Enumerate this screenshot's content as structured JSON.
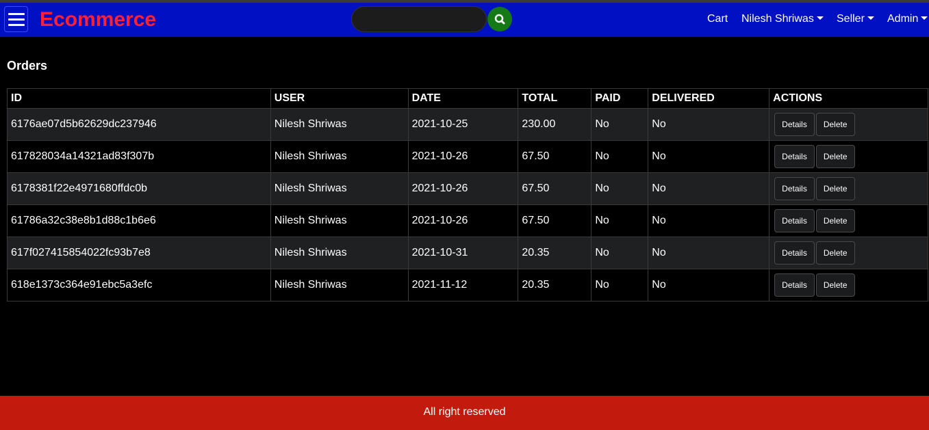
{
  "header": {
    "brand": "Ecommerce",
    "search": {
      "placeholder": "",
      "value": ""
    },
    "nav": {
      "cart": "Cart",
      "user": "Nilesh Shriwas",
      "seller": "Seller",
      "admin": "Admin"
    }
  },
  "main": {
    "title": "Orders",
    "columns": [
      "ID",
      "USER",
      "DATE",
      "TOTAL",
      "PAID",
      "DELIVERED",
      "ACTIONS"
    ],
    "action_labels": {
      "details": "Details",
      "delete": "Delete"
    },
    "rows": [
      {
        "id": "6176ae07d5b62629dc237946",
        "user": "Nilesh Shriwas",
        "date": "2021-10-25",
        "total": "230.00",
        "paid": "No",
        "delivered": "No"
      },
      {
        "id": "617828034a14321ad83f307b",
        "user": "Nilesh Shriwas",
        "date": "2021-10-26",
        "total": "67.50",
        "paid": "No",
        "delivered": "No"
      },
      {
        "id": "6178381f22e4971680ffdc0b",
        "user": "Nilesh Shriwas",
        "date": "2021-10-26",
        "total": "67.50",
        "paid": "No",
        "delivered": "No"
      },
      {
        "id": "61786a32c38e8b1d88c1b6e6",
        "user": "Nilesh Shriwas",
        "date": "2021-10-26",
        "total": "67.50",
        "paid": "No",
        "delivered": "No"
      },
      {
        "id": "617f027415854022fc93b7e8",
        "user": "Nilesh Shriwas",
        "date": "2021-10-31",
        "total": "20.35",
        "paid": "No",
        "delivered": "No"
      },
      {
        "id": "618e1373c364e91ebc5a3efc",
        "user": "Nilesh Shriwas",
        "date": "2021-11-12",
        "total": "20.35",
        "paid": "No",
        "delivered": "No"
      }
    ]
  },
  "footer": {
    "text": "All right reserved"
  },
  "colors": {
    "header_bg": "#0010c2",
    "brand": "#ff2035",
    "search_button": "#157a15",
    "footer_bg": "#c21a0d"
  },
  "icons": {
    "menu": "hamburger-icon",
    "search": "search-icon",
    "dropdown": "caret-down-icon"
  }
}
